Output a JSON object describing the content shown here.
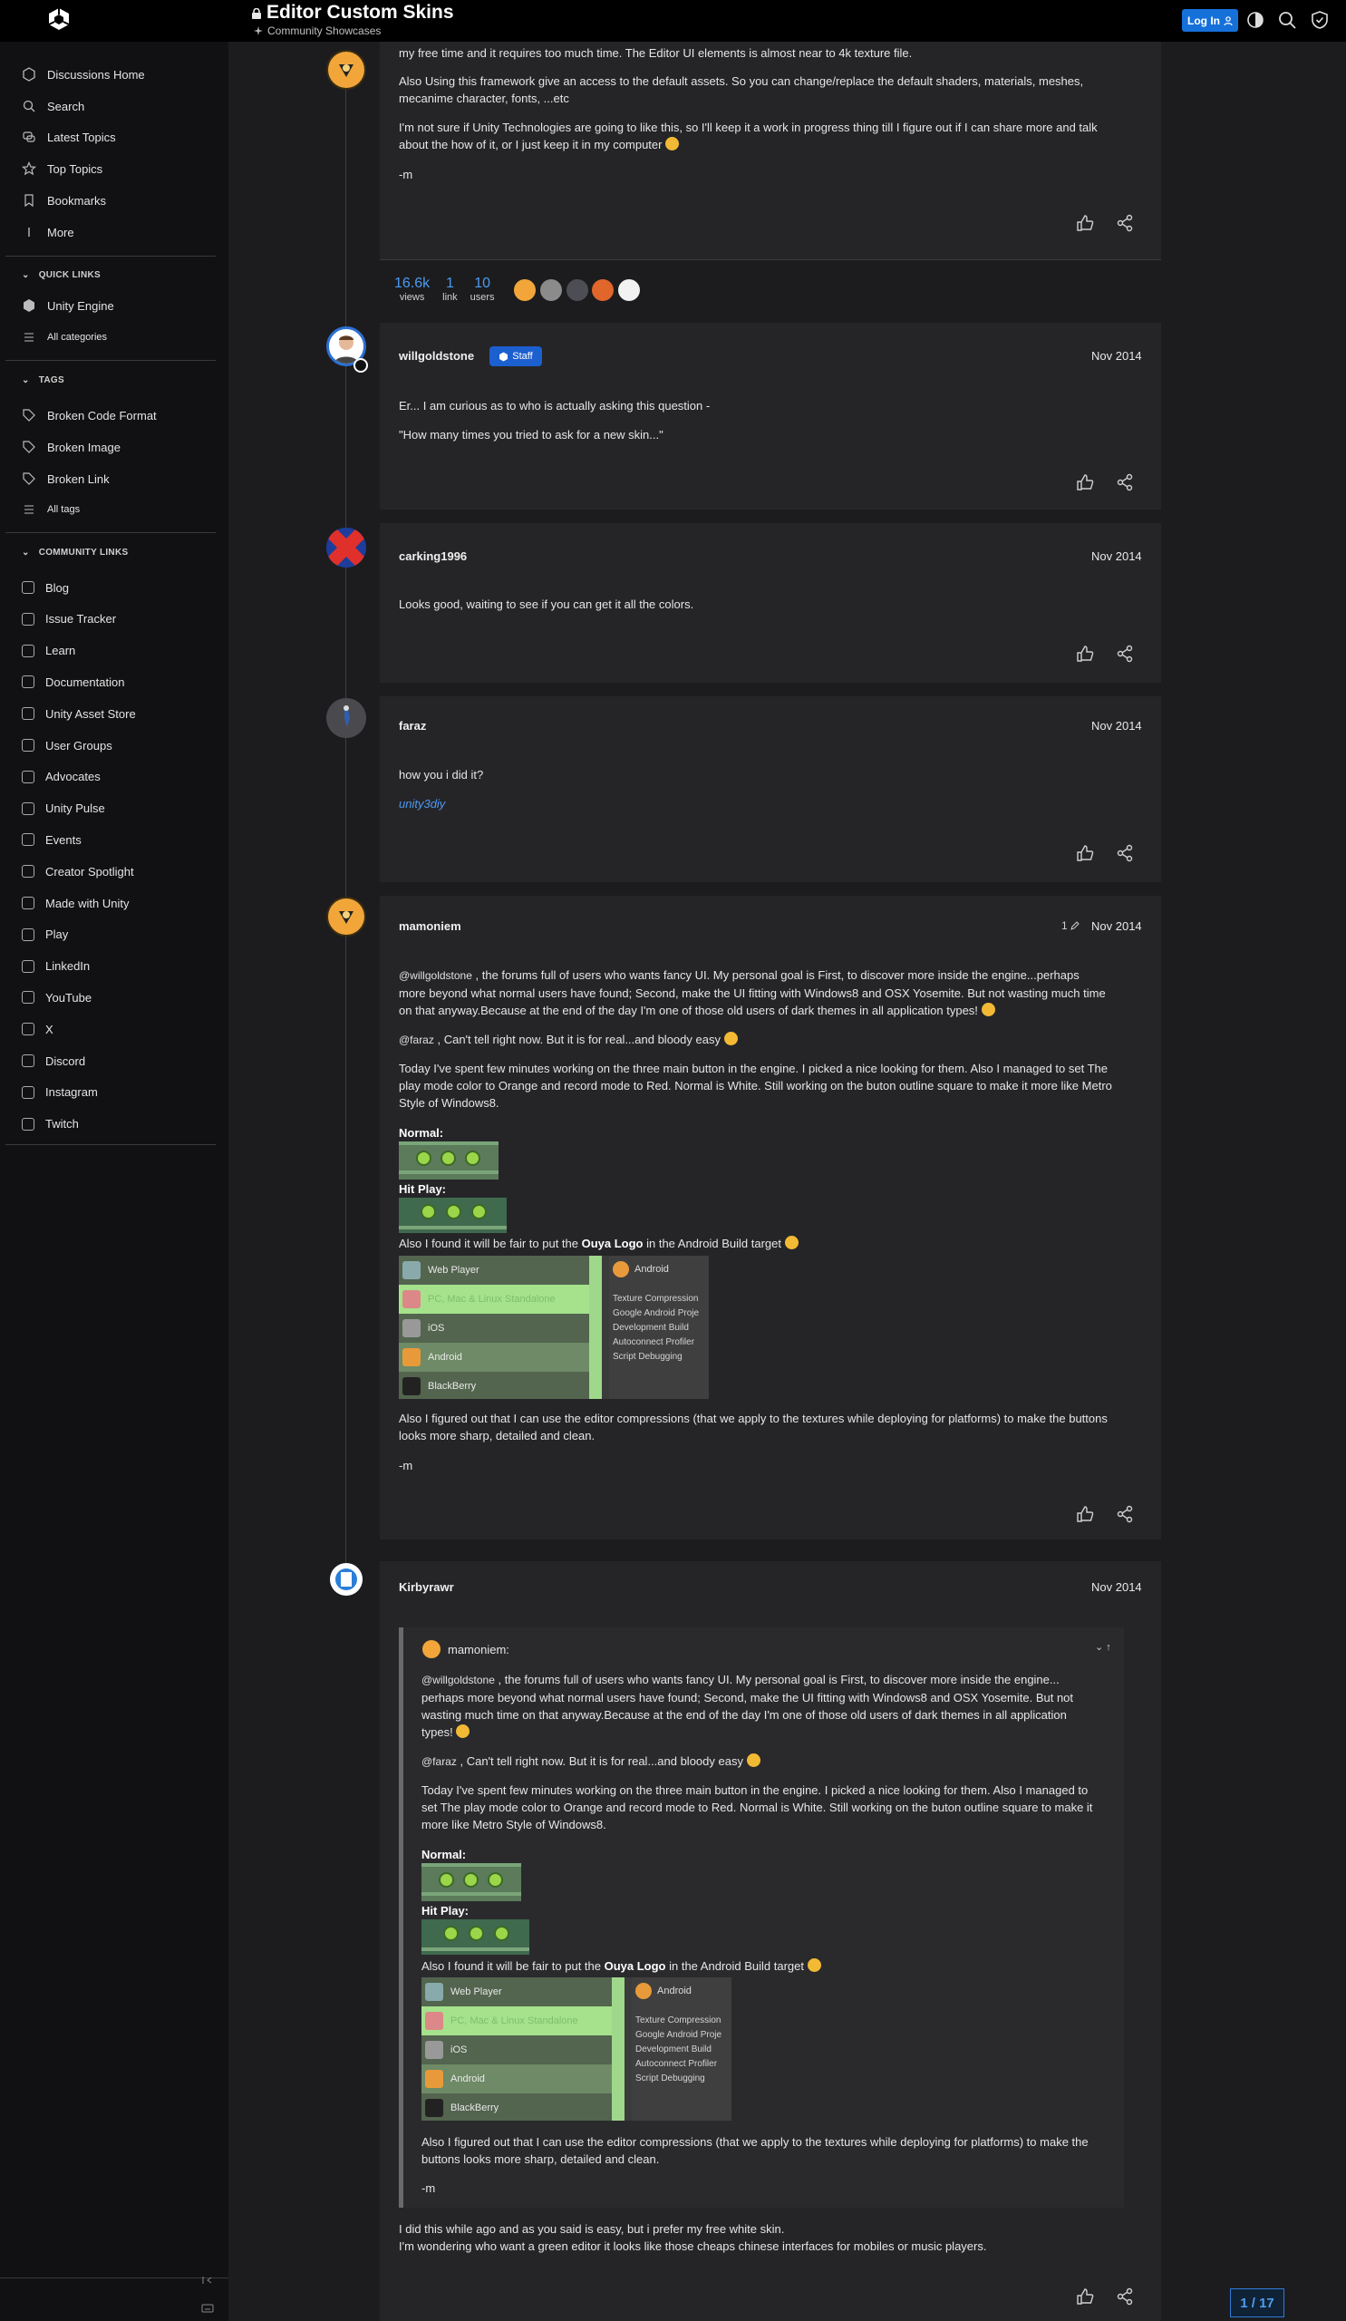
{
  "header": {
    "title": "Editor Custom Skins",
    "category": "Community Showcases",
    "login_label": "Log In",
    "icons": [
      "unity-logo-icon",
      "lock-icon",
      "sparkle-icon",
      "user-icon",
      "theme-toggle-icon",
      "search-icon",
      "shield-icon"
    ]
  },
  "sidebar": {
    "main": [
      "Discussions Home",
      "Search",
      "Latest Topics",
      "Top Topics",
      "Bookmarks",
      "More"
    ],
    "quick_links_head": "QUICK LINKS",
    "quick_links": [
      "Unity Engine",
      "All categories"
    ],
    "tags_head": "TAGS",
    "tags": [
      "Broken Code Format",
      "Broken Image",
      "Broken Link",
      "All tags"
    ],
    "community_head": "COMMUNITY LINKS",
    "community": [
      "Blog",
      "Issue Tracker",
      "Learn",
      "Documentation",
      "Unity Asset Store",
      "User Groups",
      "Advocates",
      "Unity Pulse",
      "Events",
      "Creator Spotlight",
      "Made with Unity",
      "Play",
      "LinkedIn",
      "YouTube",
      "X",
      "Discord",
      "Instagram",
      "Twitch"
    ]
  },
  "post0": {
    "p1": "my free time and it requires too much time. The Editor UI elements is almost near to 4k texture file.",
    "p2a": "Also Using this framework give an access to the default assets. So you can change/replace the default shaders, materials, meshes,",
    "p2b": "mecanime character, fonts, ...etc",
    "p3a": "I'm not sure if Unity Technologies are going to like this, so I'll keep it a work in progress thing till I figure out if I can share more and talk",
    "p3b": "about the how of it, or I just keep it in my computer",
    "sig": "-m"
  },
  "stats": {
    "views_n": "16.6k",
    "views_l": "views",
    "link_n": "1",
    "link_l": "link",
    "users_n": "10",
    "users_l": "users"
  },
  "post1": {
    "user": "willgoldstone",
    "badge": "Staff",
    "date": "Nov 2014",
    "p1": "Er... I am curious as to who is actually asking this question -",
    "p2": "\"How many times you tried to ask for a new skin...\""
  },
  "post2": {
    "user": "carking1996",
    "date": "Nov 2014",
    "p1": "Looks good, waiting to see if you can get it all the colors."
  },
  "post3": {
    "user": "faraz",
    "date": "Nov 2014",
    "p1": "how you i did it?",
    "link": "unity3diy"
  },
  "post4": {
    "user": "mamoniem",
    "edits": "1",
    "date": "Nov 2014",
    "mention1": "@willgoldstone",
    "p1a": ", the forums full of users who wants fancy UI. My personal goal is First, to discover more inside the engine...perhaps",
    "p1b": "more beyond what normal users have found; Second, make the UI fitting with Windows8 and OSX Yosemite. But not wasting much time",
    "p1c": "on that anyway.Because at the end of the day I'm one of those old users of dark themes in all application types!",
    "mention2": "@faraz",
    "p2": ", Can't tell right now. But it is for real...and bloody easy",
    "p3a": "Today I've spent few minutes working on the three main button in the engine. I picked a nice looking for them. Also I managed to set The",
    "p3b": "play mode color to Orange and record mode to Red. Normal is White. Still working on the buton outline square to make it more like Metro",
    "p3c": "Style of Windows8.",
    "normal": "Normal:",
    "hitplay": "Hit Play:",
    "p4a": "Also I found it will be fair to put the ",
    "p4b": "Ouya Logo",
    "p4c": " in the Android Build target",
    "p5a": "Also I figured out that I can use the editor compressions (that we apply to the textures while deploying for platforms) to make the buttons",
    "p5b": "looks more sharp, detailed and clean.",
    "sig": "-m"
  },
  "build": {
    "rows": [
      "Web Player",
      "PC, Mac & Linux Standalone",
      "iOS",
      "Android",
      "BlackBerry"
    ],
    "right_title": "Android",
    "right_items": [
      "Texture Compression",
      "Google Android Proje",
      "Development Build",
      "Autoconnect Profiler",
      "Script Debugging"
    ]
  },
  "post5": {
    "user": "Kirbyrawr",
    "date": "Nov 2014",
    "quote_user": "mamoniem:",
    "q1a": ", the forums full of users who wants fancy UI. My personal goal is First, to discover more inside the engine...",
    "q1b": "perhaps more beyond what normal users have found; Second, make the UI fitting with Windows8 and OSX Yosemite. But not",
    "q1c": "wasting much time on that anyway.Because at the end of the day I'm one of those old users of dark themes in all application",
    "q1d": "types!",
    "q3a": "Today I've spent few minutes working on the three main button in the engine. I picked a nice looking for them. Also I managed to",
    "q3b": "set The play mode color to Orange and record mode to Red. Normal is White. Still working on the buton outline square to make it",
    "q3c": "more like Metro Style of Windows8.",
    "q5a": "Also I figured out that I can use the editor compressions (that we apply to the textures while deploying for platforms) to make the",
    "q5b": "buttons looks more sharp, detailed and clean.",
    "r1": "I did this while ago and as you said is easy, but i prefer my free white skin.",
    "r2": "I'm wondering who want a green editor it looks like those cheaps chinese interfaces for mobiles or music players."
  },
  "progress": "1 / 17",
  "colors": {
    "accent": "#1670d9",
    "link": "#4b9af2",
    "bg": "#1c1c1e",
    "post_bg": "#252528",
    "sidebar_bg": "#111113"
  }
}
